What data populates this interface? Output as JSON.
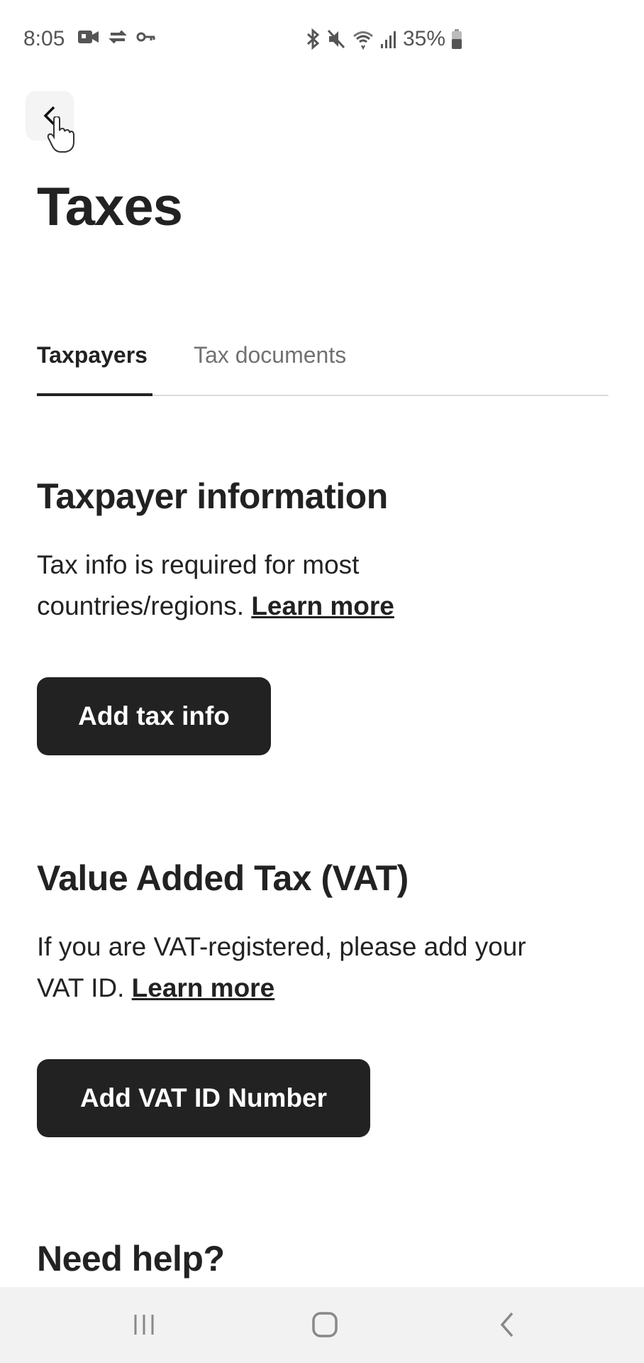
{
  "status_bar": {
    "time": "8:05",
    "left_icons": [
      "video-camera-icon",
      "sync-icon",
      "vpn-key-icon"
    ],
    "right_icons": [
      "bluetooth-icon",
      "mute-icon",
      "wifi-icon",
      "signal-icon"
    ],
    "battery": "35%"
  },
  "header": {
    "back_icon": "chevron-left-icon",
    "title": "Taxes"
  },
  "tabs": [
    {
      "label": "Taxpayers",
      "active": true
    },
    {
      "label": "Tax documents",
      "active": false
    }
  ],
  "sections": {
    "taxpayer": {
      "heading": "Taxpayer information",
      "body_line1": "Tax info is required for most",
      "body_line2": "countries/regions.",
      "link": "Learn more",
      "button": "Add tax info"
    },
    "vat": {
      "heading": "Value Added Tax (VAT)",
      "body_line1": "If you are VAT-registered, please add your",
      "body_line2": "VAT ID.",
      "link": "Learn more",
      "button": "Add VAT ID Number"
    },
    "help": {
      "heading": "Need help?"
    }
  },
  "nav_bar": {
    "items": [
      "recent-apps-icon",
      "home-icon",
      "back-icon"
    ]
  },
  "colors": {
    "primary": "#222222",
    "muted": "#717171",
    "background": "#ffffff",
    "nav_background": "#f2f2f2"
  }
}
